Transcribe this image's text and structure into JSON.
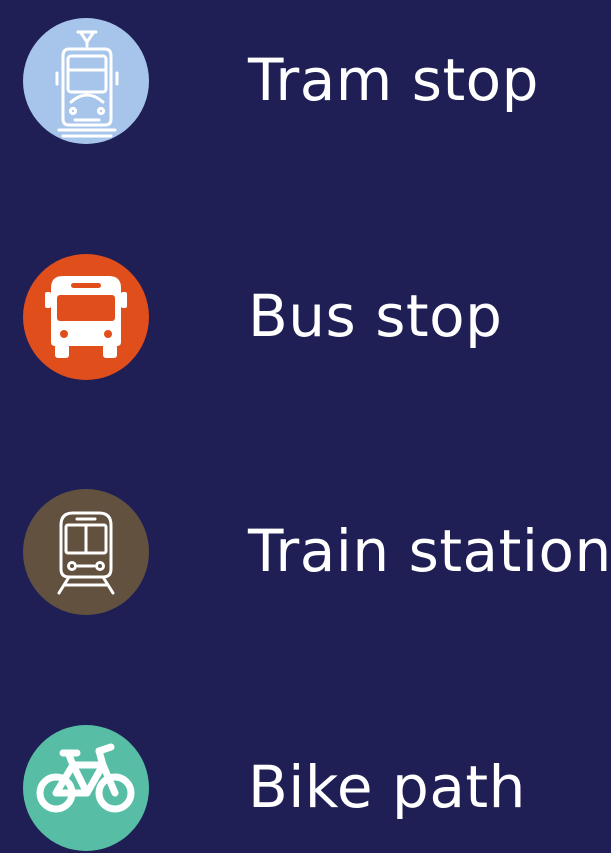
{
  "legend": {
    "items": [
      {
        "id": "tram",
        "label": "Tram stop",
        "icon": "tram-icon",
        "color": "#a7c5ea"
      },
      {
        "id": "bus",
        "label": "Bus stop",
        "icon": "bus-icon",
        "color": "#e04e1c"
      },
      {
        "id": "train",
        "label": "Train station",
        "icon": "train-icon",
        "color": "#62513f"
      },
      {
        "id": "bike",
        "label": "Bike path",
        "icon": "bike-icon",
        "color": "#57bea5"
      }
    ]
  },
  "colors": {
    "background": "#1f1f55",
    "text": "#ffffff"
  }
}
